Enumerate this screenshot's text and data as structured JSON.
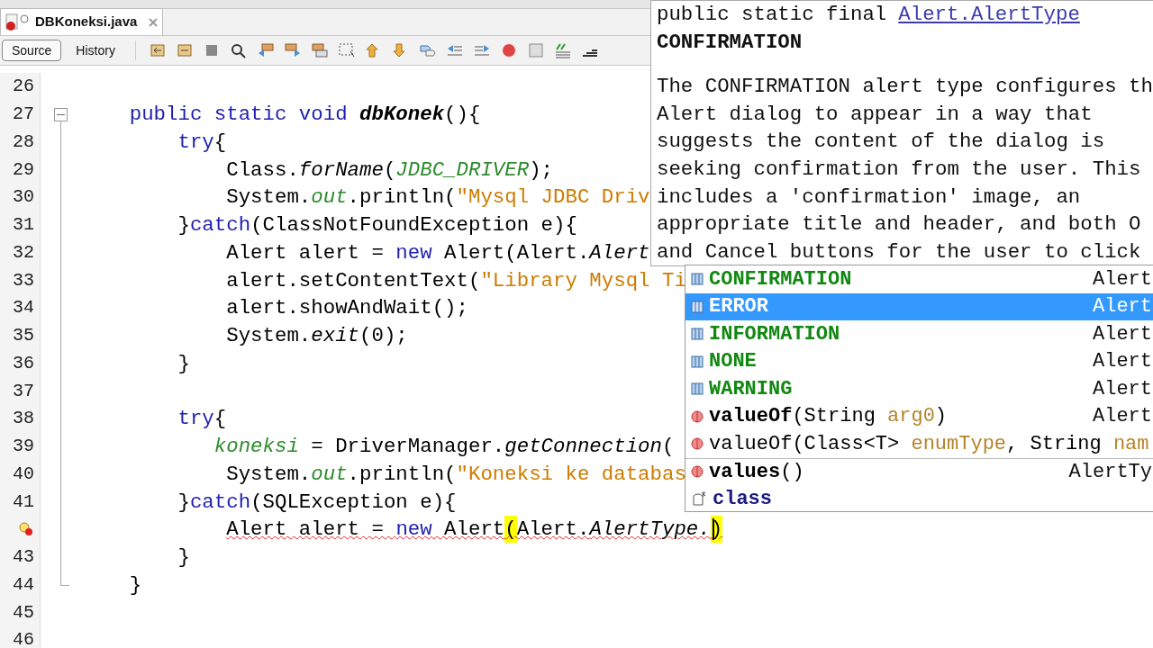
{
  "tab": {
    "title": "DBKoneksi.java"
  },
  "view_buttons": [
    {
      "label": "Source",
      "selected": true
    },
    {
      "label": "History",
      "selected": false
    }
  ],
  "editor": {
    "lines": [
      {
        "number": "26"
      },
      {
        "number": "27",
        "fold_start": true,
        "tokens": [
          {
            "kind": "keyword",
            "text": "    public static void "
          },
          {
            "kind": "declaration",
            "text": "dbKonek"
          },
          {
            "kind": "plain",
            "text": "(){"
          }
        ]
      },
      {
        "number": "28",
        "tokens": [
          {
            "kind": "keyword",
            "text": "        try"
          },
          {
            "kind": "plain",
            "text": "{"
          }
        ]
      },
      {
        "number": "29",
        "tokens": [
          {
            "kind": "plain",
            "text": "            Class."
          },
          {
            "kind": "static",
            "text": "forName"
          },
          {
            "kind": "plain",
            "text": "("
          },
          {
            "kind": "field",
            "text": "JDBC_DRIVER"
          },
          {
            "kind": "plain",
            "text": ");"
          }
        ]
      },
      {
        "number": "30",
        "tokens": [
          {
            "kind": "plain",
            "text": "            System."
          },
          {
            "kind": "field",
            "text": "out"
          },
          {
            "kind": "plain",
            "text": ".println("
          },
          {
            "kind": "string",
            "text": "\"Mysql JDBC Driv"
          }
        ]
      },
      {
        "number": "31",
        "tokens": [
          {
            "kind": "plain",
            "text": "        }"
          },
          {
            "kind": "keyword",
            "text": "catch"
          },
          {
            "kind": "plain",
            "text": "(ClassNotFoundException e){"
          }
        ]
      },
      {
        "number": "32",
        "tokens": [
          {
            "kind": "plain",
            "text": "            Alert alert = "
          },
          {
            "kind": "keyword",
            "text": "new"
          },
          {
            "kind": "plain",
            "text": " Alert(Alert."
          },
          {
            "kind": "static",
            "text": "Alert"
          }
        ]
      },
      {
        "number": "33",
        "tokens": [
          {
            "kind": "plain",
            "text": "            alert.setContentText("
          },
          {
            "kind": "string",
            "text": "\"Library Mysql Ti"
          }
        ]
      },
      {
        "number": "34",
        "tokens": [
          {
            "kind": "plain",
            "text": "            alert.showAndWait();"
          }
        ]
      },
      {
        "number": "35",
        "tokens": [
          {
            "kind": "plain",
            "text": "            System."
          },
          {
            "kind": "static",
            "text": "exit"
          },
          {
            "kind": "plain",
            "text": "(0);"
          }
        ]
      },
      {
        "number": "36",
        "tokens": [
          {
            "kind": "plain",
            "text": "        }"
          }
        ]
      },
      {
        "number": "37"
      },
      {
        "number": "38",
        "tokens": [
          {
            "kind": "keyword",
            "text": "        try"
          },
          {
            "kind": "plain",
            "text": "{"
          }
        ]
      },
      {
        "number": "39",
        "tokens": [
          {
            "kind": "field",
            "text": "           koneksi"
          },
          {
            "kind": "plain",
            "text": " = DriverManager."
          },
          {
            "kind": "static",
            "text": "getConnection"
          },
          {
            "kind": "plain",
            "text": "("
          }
        ]
      },
      {
        "number": "40",
        "tokens": [
          {
            "kind": "plain",
            "text": "            System."
          },
          {
            "kind": "field",
            "text": "out"
          },
          {
            "kind": "plain",
            "text": ".println("
          },
          {
            "kind": "string",
            "text": "\"Koneksi ke databas"
          }
        ]
      },
      {
        "number": "41",
        "tokens": [
          {
            "kind": "plain",
            "text": "        }"
          },
          {
            "kind": "keyword",
            "text": "catch"
          },
          {
            "kind": "plain",
            "text": "(SQLException e){"
          }
        ]
      },
      {
        "error": true,
        "caret": true,
        "tokens": [
          {
            "kind": "plain",
            "text": "            Alert alert = "
          },
          {
            "kind": "keyword",
            "text": "new"
          },
          {
            "kind": "plain",
            "text": " Alert"
          },
          {
            "kind": "bracket",
            "text": "("
          },
          {
            "kind": "plain",
            "text": "Alert."
          },
          {
            "kind": "static",
            "text": "AlertType."
          },
          {
            "kind": "bracket",
            "text": ")"
          }
        ]
      },
      {
        "number": "43",
        "tokens": [
          {
            "kind": "plain",
            "text": "        }"
          }
        ]
      },
      {
        "number": "44",
        "fold_end": true,
        "tokens": [
          {
            "kind": "plain",
            "text": "    }"
          }
        ]
      },
      {
        "number": "45"
      },
      {
        "number": "46"
      }
    ]
  },
  "doc": {
    "prefix": "public static final",
    "link": "Alert.AlertType",
    "name": "CONFIRMATION",
    "lines": [
      "The CONFIRMATION alert type configures th",
      "Alert dialog to appear in a way that",
      "suggests the content of the dialog is",
      "seeking confirmation from the user. This",
      "includes a 'confirmation' image, an",
      "appropriate title and header, and both O",
      "and Cancel buttons for the user to click"
    ]
  },
  "completion": {
    "items": [
      {
        "kind": "constant",
        "name": "CONFIRMATION",
        "type": "Alert",
        "selected": false
      },
      {
        "kind": "constant",
        "name": "ERROR",
        "type": "Alert",
        "selected": true
      },
      {
        "kind": "constant",
        "name": "INFORMATION",
        "type": "Alert",
        "selected": false
      },
      {
        "kind": "constant",
        "name": "NONE",
        "type": "Alert",
        "selected": false
      },
      {
        "kind": "constant",
        "name": "WARNING",
        "type": "Alert",
        "selected": false
      },
      {
        "kind": "method",
        "name": "valueOf",
        "bold": true,
        "params": [
          {
            "kind": "plain",
            "text": "(String "
          },
          {
            "kind": "argument",
            "text": "arg0"
          },
          {
            "kind": "plain",
            "text": ")"
          }
        ],
        "type": "Alert",
        "selected": false
      },
      {
        "kind": "method",
        "name": "valueOf",
        "bold": false,
        "params": [
          {
            "kind": "plain",
            "text": "(Class<T> "
          },
          {
            "kind": "argument",
            "text": "enumType"
          },
          {
            "kind": "plain",
            "text": ", String "
          },
          {
            "kind": "argument",
            "text": "nam"
          }
        ],
        "selected": false
      },
      {
        "kind": "method",
        "name": "values",
        "bold": true,
        "separator": true,
        "params": [
          {
            "kind": "plain",
            "text": "()"
          }
        ],
        "type": "AlertTy",
        "selected": false
      },
      {
        "kind": "keyword",
        "name": "class",
        "selected": false
      }
    ]
  }
}
